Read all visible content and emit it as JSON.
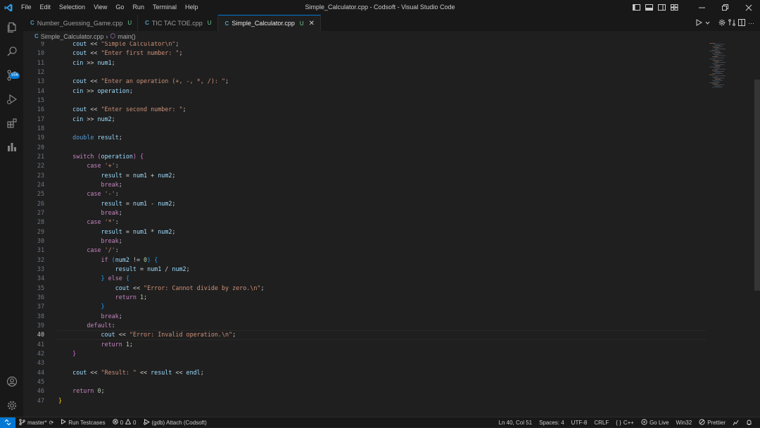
{
  "window": {
    "title": "Simple_Calculator.cpp - Codsoft - Visual Studio Code",
    "menu": [
      "File",
      "Edit",
      "Selection",
      "View",
      "Go",
      "Run",
      "Terminal",
      "Help"
    ]
  },
  "activity_bar": {
    "scm_badge": "556"
  },
  "tabs": [
    {
      "label": "Number_Guessing_Game.cpp",
      "status": "U",
      "active": false
    },
    {
      "label": "TIC TAC TOE.cpp",
      "status": "U",
      "active": false
    },
    {
      "label": "Simple_Calculator.cpp",
      "status": "U",
      "active": true
    }
  ],
  "breadcrumb": {
    "file": "Simple_Calculator.cpp",
    "symbol": "main()"
  },
  "editor": {
    "current_line": 40,
    "lines": [
      {
        "n": 9,
        "html": "    <span class='var'>cout</span> << <span class='str'>\"Simple Calculator\\n\"</span>;"
      },
      {
        "n": 10,
        "html": "    <span class='var'>cout</span> << <span class='str'>\"Enter first number: \"</span>;"
      },
      {
        "n": 11,
        "html": "    <span class='var'>cin</span> >> <span class='var'>num1</span>;"
      },
      {
        "n": 12,
        "html": ""
      },
      {
        "n": 13,
        "html": "    <span class='var'>cout</span> << <span class='str'>\"Enter an operation (+, -, *, /): \"</span>;"
      },
      {
        "n": 14,
        "html": "    <span class='var'>cin</span> >> <span class='var'>operation</span>;"
      },
      {
        "n": 15,
        "html": ""
      },
      {
        "n": 16,
        "html": "    <span class='var'>cout</span> << <span class='str'>\"Enter second number: \"</span>;"
      },
      {
        "n": 17,
        "html": "    <span class='var'>cin</span> >> <span class='var'>num2</span>;"
      },
      {
        "n": 18,
        "html": ""
      },
      {
        "n": 19,
        "html": "    <span class='ty'>double</span> <span class='var'>result</span>;"
      },
      {
        "n": 20,
        "html": ""
      },
      {
        "n": 21,
        "html": "    <span class='ctl'>switch</span> <span class='bk2'>(</span><span class='var'>operation</span><span class='bk2'>)</span> <span class='bk2'>{</span>"
      },
      {
        "n": 22,
        "html": "        <span class='ctl'>case</span> <span class='str'>'+'</span>:"
      },
      {
        "n": 23,
        "html": "            <span class='var'>result</span> = <span class='var'>num1</span> + <span class='var'>num2</span>;"
      },
      {
        "n": 24,
        "html": "            <span class='ctl'>break</span>;"
      },
      {
        "n": 25,
        "html": "        <span class='ctl'>case</span> <span class='str'>'-'</span>:"
      },
      {
        "n": 26,
        "html": "            <span class='var'>result</span> = <span class='var'>num1</span> - <span class='var'>num2</span>;"
      },
      {
        "n": 27,
        "html": "            <span class='ctl'>break</span>;"
      },
      {
        "n": 28,
        "html": "        <span class='ctl'>case</span> <span class='str'>'*'</span>:"
      },
      {
        "n": 29,
        "html": "            <span class='var'>result</span> = <span class='var'>num1</span> * <span class='var'>num2</span>;"
      },
      {
        "n": 30,
        "html": "            <span class='ctl'>break</span>;"
      },
      {
        "n": 31,
        "html": "        <span class='ctl'>case</span> <span class='str'>'/'</span>:"
      },
      {
        "n": 32,
        "html": "            <span class='ctl'>if</span> <span class='bk3'>(</span><span class='var'>num2</span> != <span class='num'>0</span><span class='bk3'>)</span> <span class='bk3'>{</span>"
      },
      {
        "n": 33,
        "html": "                <span class='var'>result</span> = <span class='var'>num1</span> / <span class='var'>num2</span>;"
      },
      {
        "n": 34,
        "html": "            <span class='bk3'>}</span> <span class='ctl'>else</span> <span class='bk3'>{</span>"
      },
      {
        "n": 35,
        "html": "                <span class='var'>cout</span> << <span class='str'>\"Error: Cannot divide by zero.\\n\"</span>;"
      },
      {
        "n": 36,
        "html": "                <span class='ctl'>return</span> <span class='num'>1</span>;"
      },
      {
        "n": 37,
        "html": "            <span class='bk3'>}</span>"
      },
      {
        "n": 38,
        "html": "            <span class='ctl'>break</span>;"
      },
      {
        "n": 39,
        "html": "        <span class='ctl'>default</span>:"
      },
      {
        "n": 40,
        "html": "            <span class='var'>cout</span> << <span class='str'>\"Error: Invalid operation.\\n\"</span>;"
      },
      {
        "n": 41,
        "html": "            <span class='ctl'>return</span> <span class='num'>1</span>;"
      },
      {
        "n": 42,
        "html": "    <span class='bk2'>}</span>"
      },
      {
        "n": 43,
        "html": ""
      },
      {
        "n": 44,
        "html": "    <span class='var'>cout</span> << <span class='str'>\"Result: \"</span> << <span class='var'>result</span> << <span class='var'>endl</span>;"
      },
      {
        "n": 45,
        "html": ""
      },
      {
        "n": 46,
        "html": "    <span class='ctl'>return</span> <span class='num'>0</span>;"
      },
      {
        "n": 47,
        "html": "<span class='bk1'>}</span>"
      }
    ]
  },
  "status_bar": {
    "branch": "master*",
    "run_testcases": "Run Testcases",
    "errors": "0",
    "warnings": "0",
    "debug": "(gdb) Attach (Codsoft)",
    "position": "Ln 40, Col 51",
    "spaces": "Spaces: 4",
    "encoding": "UTF-8",
    "eol": "CRLF",
    "language": "C++",
    "go_live": "Go Live",
    "platform": "Win32",
    "prettier": "Prettier"
  },
  "colors": {
    "accent": "#0078d4",
    "background": "#1f1f1f",
    "chrome": "#181818"
  }
}
